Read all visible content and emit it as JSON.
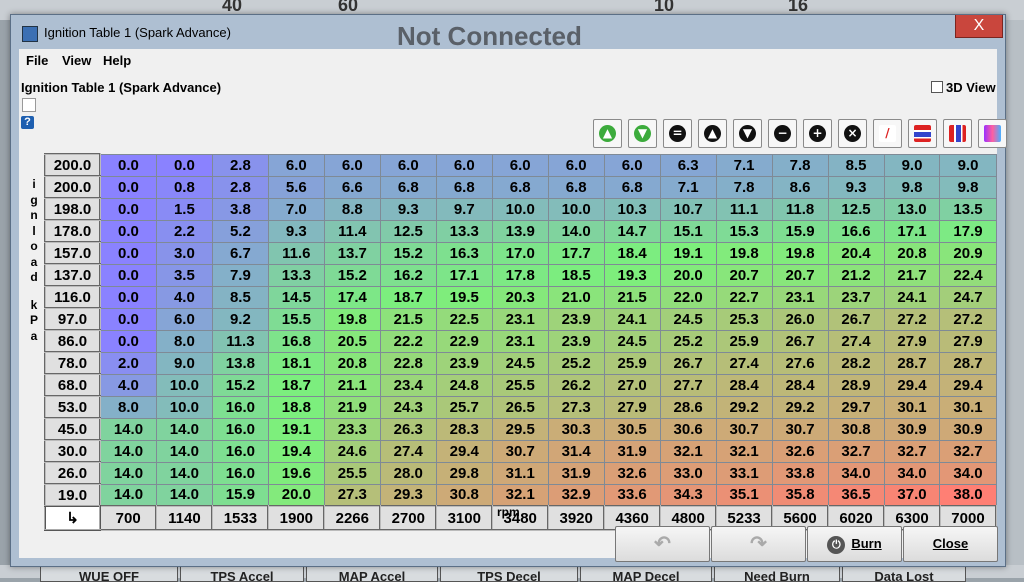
{
  "background": {
    "gauge_numbers": [
      "40",
      "60",
      "10",
      "16"
    ],
    "status_text": "Not Connected",
    "bottom_buttons": [
      "WUE OFF",
      "TPS Accel",
      "MAP Accel",
      "TPS Decel",
      "MAP Decel",
      "Need Burn",
      "Data Lost"
    ]
  },
  "window": {
    "title": "Ignition Table 1 (Spark Advance)",
    "close_icon": "X"
  },
  "menu": {
    "file": "File",
    "view": "View",
    "help": "Help"
  },
  "panel": {
    "title": "Ignition Table 1 (Spark Advance)",
    "view3d_label": "3D View",
    "help_icon": "?"
  },
  "toolbar": [
    {
      "name": "increase-icon",
      "glyph": "▲",
      "color": "#3cab3c"
    },
    {
      "name": "decrease-icon",
      "glyph": "▼",
      "color": "#3cab3c"
    },
    {
      "name": "equal-icon",
      "glyph": "=",
      "color": "#111111"
    },
    {
      "name": "up-icon",
      "glyph": "▲",
      "color": "#111111"
    },
    {
      "name": "down-icon",
      "glyph": "▼",
      "color": "#111111"
    },
    {
      "name": "minus-icon",
      "glyph": "−",
      "color": "#111111"
    },
    {
      "name": "plus-icon",
      "glyph": "+",
      "color": "#111111"
    },
    {
      "name": "multiply-icon",
      "glyph": "×",
      "color": "#111111"
    },
    {
      "name": "interpolate-icon",
      "glyph": "/",
      "color": "#ffffff"
    },
    {
      "name": "horizontal-lines-icon",
      "glyph": "≡",
      "color": "#ffffff"
    },
    {
      "name": "vertical-lines-icon",
      "glyph": "|||",
      "color": "#ffffff"
    },
    {
      "name": "color-gradient-icon",
      "glyph": "",
      "color": "#ffffff"
    }
  ],
  "y_axis_label": "ignload kPa",
  "x_axis_label": "rpm",
  "corner_glyph": "↳",
  "rpm": [
    "700",
    "1140",
    "1533",
    "1900",
    "2266",
    "2700",
    "3100",
    "3480",
    "3920",
    "4360",
    "4800",
    "5233",
    "5600",
    "6020",
    "6300",
    "7000"
  ],
  "load": [
    "200.0",
    "200.0",
    "198.0",
    "178.0",
    "157.0",
    "137.0",
    "116.0",
    "97.0",
    "86.0",
    "78.0",
    "68.0",
    "53.0",
    "45.0",
    "30.0",
    "26.0",
    "19.0"
  ],
  "values": [
    [
      "0.0",
      "0.0",
      "2.8",
      "6.0",
      "6.0",
      "6.0",
      "6.0",
      "6.0",
      "6.0",
      "6.0",
      "6.3",
      "7.1",
      "7.8",
      "8.5",
      "9.0",
      "9.0"
    ],
    [
      "0.0",
      "0.8",
      "2.8",
      "5.6",
      "6.6",
      "6.8",
      "6.8",
      "6.8",
      "6.8",
      "6.8",
      "7.1",
      "7.8",
      "8.6",
      "9.3",
      "9.8",
      "9.8"
    ],
    [
      "0.0",
      "1.5",
      "3.8",
      "7.0",
      "8.8",
      "9.3",
      "9.7",
      "10.0",
      "10.0",
      "10.3",
      "10.7",
      "11.1",
      "11.8",
      "12.5",
      "13.0",
      "13.5"
    ],
    [
      "0.0",
      "2.2",
      "5.2",
      "9.3",
      "11.4",
      "12.5",
      "13.3",
      "13.9",
      "14.0",
      "14.7",
      "15.1",
      "15.3",
      "15.9",
      "16.6",
      "17.1",
      "17.9"
    ],
    [
      "0.0",
      "3.0",
      "6.7",
      "11.6",
      "13.7",
      "15.2",
      "16.3",
      "17.0",
      "17.7",
      "18.4",
      "19.1",
      "19.8",
      "19.8",
      "20.4",
      "20.8",
      "20.9"
    ],
    [
      "0.0",
      "3.5",
      "7.9",
      "13.3",
      "15.2",
      "16.2",
      "17.1",
      "17.8",
      "18.5",
      "19.3",
      "20.0",
      "20.7",
      "20.7",
      "21.2",
      "21.7",
      "22.4"
    ],
    [
      "0.0",
      "4.0",
      "8.5",
      "14.5",
      "17.4",
      "18.7",
      "19.5",
      "20.3",
      "21.0",
      "21.5",
      "22.0",
      "22.7",
      "23.1",
      "23.7",
      "24.1",
      "24.7"
    ],
    [
      "0.0",
      "6.0",
      "9.2",
      "15.5",
      "19.8",
      "21.5",
      "22.5",
      "23.1",
      "23.9",
      "24.1",
      "24.5",
      "25.3",
      "26.0",
      "26.7",
      "27.2",
      "27.2"
    ],
    [
      "0.0",
      "8.0",
      "11.3",
      "16.8",
      "20.5",
      "22.2",
      "22.9",
      "23.1",
      "23.9",
      "24.5",
      "25.2",
      "25.9",
      "26.7",
      "27.4",
      "27.9",
      "27.9"
    ],
    [
      "2.0",
      "9.0",
      "13.8",
      "18.1",
      "20.8",
      "22.8",
      "23.9",
      "24.5",
      "25.2",
      "25.9",
      "26.7",
      "27.4",
      "27.6",
      "28.2",
      "28.7",
      "28.7"
    ],
    [
      "4.0",
      "10.0",
      "15.2",
      "18.7",
      "21.1",
      "23.4",
      "24.8",
      "25.5",
      "26.2",
      "27.0",
      "27.7",
      "28.4",
      "28.4",
      "28.9",
      "29.4",
      "29.4"
    ],
    [
      "8.0",
      "10.0",
      "16.0",
      "18.8",
      "21.9",
      "24.3",
      "25.7",
      "26.5",
      "27.3",
      "27.9",
      "28.6",
      "29.2",
      "29.2",
      "29.7",
      "30.1",
      "30.1"
    ],
    [
      "14.0",
      "14.0",
      "16.0",
      "19.1",
      "23.3",
      "26.3",
      "28.3",
      "29.5",
      "30.3",
      "30.5",
      "30.6",
      "30.7",
      "30.7",
      "30.8",
      "30.9",
      "30.9"
    ],
    [
      "14.0",
      "14.0",
      "16.0",
      "19.4",
      "24.6",
      "27.4",
      "29.4",
      "30.7",
      "31.4",
      "31.9",
      "32.1",
      "32.1",
      "32.6",
      "32.7",
      "32.7",
      "32.7"
    ],
    [
      "14.0",
      "14.0",
      "16.0",
      "19.6",
      "25.5",
      "28.0",
      "29.8",
      "31.1",
      "31.9",
      "32.6",
      "33.0",
      "33.1",
      "33.8",
      "34.0",
      "34.0",
      "34.0"
    ],
    [
      "14.0",
      "14.0",
      "15.9",
      "20.0",
      "27.3",
      "29.3",
      "30.8",
      "32.1",
      "32.9",
      "33.6",
      "34.3",
      "35.1",
      "35.8",
      "36.5",
      "37.0",
      "38.0"
    ]
  ],
  "buttons": {
    "undo": "↶",
    "redo": "↷",
    "burn": "Burn",
    "close": "Close",
    "burn_icon": "⏻"
  },
  "colors": {
    "low": "#8a82ff",
    "mid": "#7cf07c",
    "high": "#ff7f74"
  }
}
